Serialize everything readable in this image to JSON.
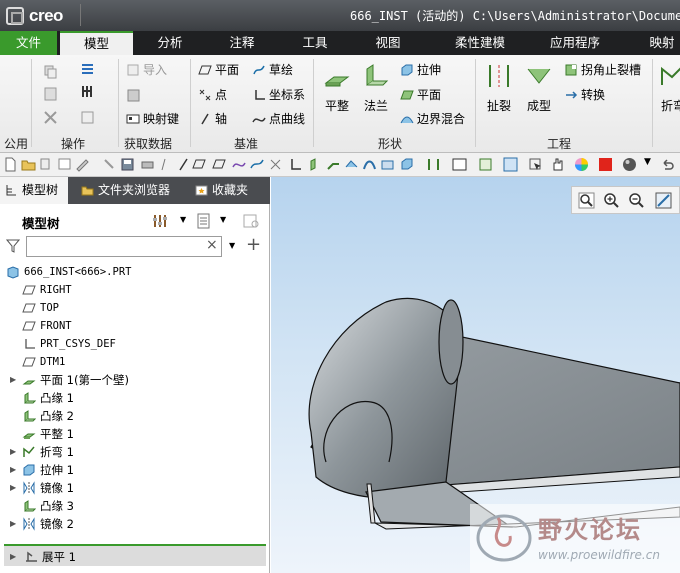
{
  "app": {
    "logo_text": "creo",
    "window_title": "666_INST (活动的) C:\\Users\\Administrator\\Documen"
  },
  "tabs": [
    "文件",
    "模型",
    "分析",
    "注释",
    "工具",
    "视图",
    "柔性建模",
    "应用程序",
    "映射"
  ],
  "active_tab": "模型",
  "ribbon": {
    "groups": [
      "公用",
      "操作",
      "获取数据",
      "基准",
      "形状",
      "工程",
      "折弯"
    ],
    "get_data": {
      "import": "导入",
      "map_key": "映射键"
    },
    "datum": {
      "plane": "平面",
      "sketch": "草绘",
      "point": "点",
      "csys": "坐标系",
      "axis": "轴",
      "curve": "点曲线"
    },
    "shape": {
      "flat": "平整",
      "flange": "法兰",
      "extrude": "拉伸",
      "plane": "平面",
      "boundary_blend": "边界混合"
    },
    "engineering": {
      "rip": "扯裂",
      "form": "成型",
      "relief": "拐角止裂槽",
      "convert": "转换"
    },
    "bend": {
      "fold": "折弯"
    }
  },
  "left_panel": {
    "tabs": [
      "模型树",
      "文件夹浏览器",
      "收藏夹"
    ],
    "header": "模型树",
    "filter": {
      "value": "",
      "clear": "×"
    },
    "tree": [
      {
        "label": "666_INST<666>.PRT",
        "mono": true
      },
      {
        "label": "RIGHT",
        "mono": true
      },
      {
        "label": "TOP",
        "mono": true
      },
      {
        "label": "FRONT",
        "mono": true
      },
      {
        "label": "PRT_CSYS_DEF",
        "mono": true
      },
      {
        "label": "DTM1",
        "mono": true
      },
      {
        "label": "平面 1(第一个壁)"
      },
      {
        "label": "凸缘 1"
      },
      {
        "label": "凸缘 2"
      },
      {
        "label": "平整 1"
      },
      {
        "label": "折弯 1"
      },
      {
        "label": "拉伸 1"
      },
      {
        "label": "镜像 1"
      },
      {
        "label": "凸缘 3"
      },
      {
        "label": "镜像 2"
      }
    ],
    "footer_item": "展平 1"
  },
  "watermark": {
    "title": "野火论坛",
    "url": "www.proewildfire.cn"
  },
  "colors": {
    "accent": "#3a9a2c",
    "title_bg": "#4a4d52",
    "viewport_top": "#b6d3ee"
  }
}
